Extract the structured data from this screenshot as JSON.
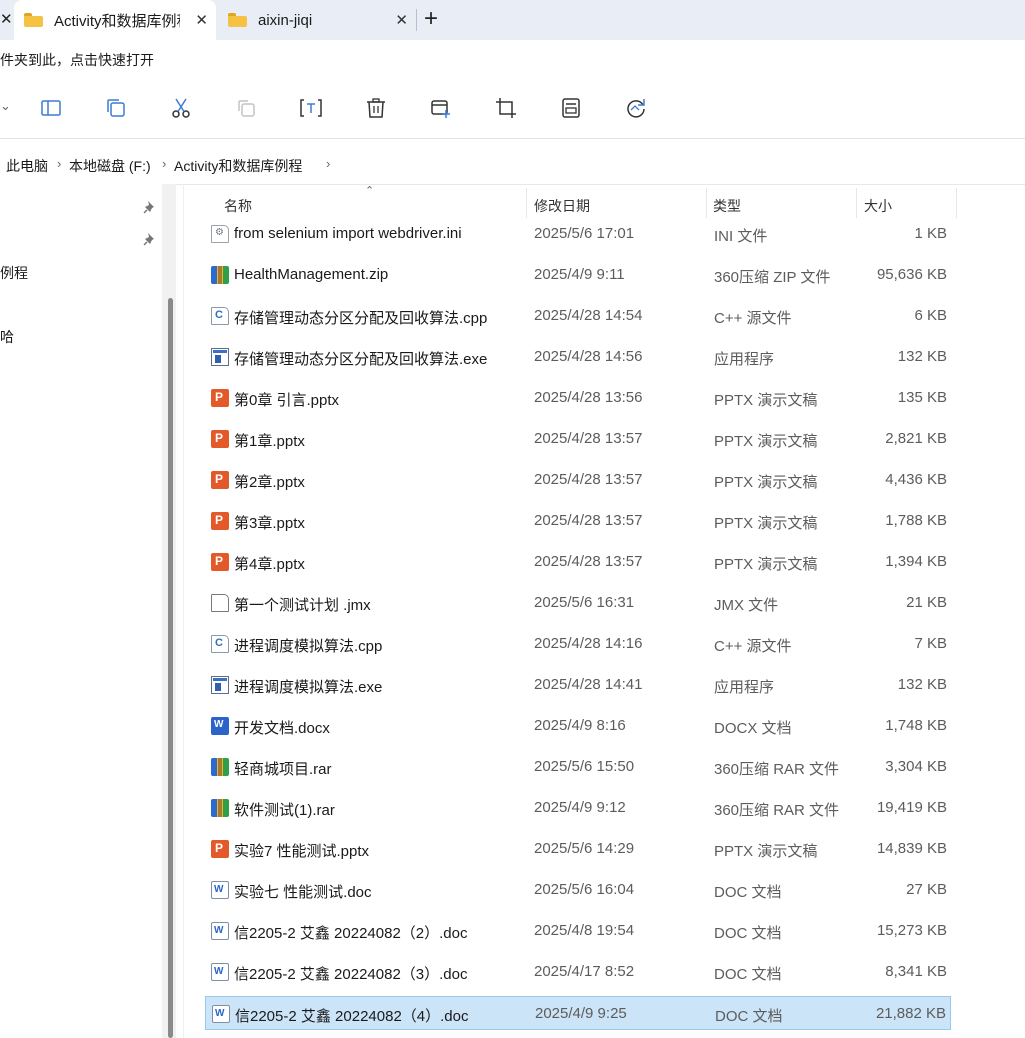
{
  "tabs": [
    {
      "title": "Activity和数据库例程",
      "active": true
    },
    {
      "title": "aixin-jiqi",
      "active": false
    }
  ],
  "infobar": {
    "text": "件夹到此，点击快速打开"
  },
  "toolbar": {
    "icons": [
      "details-pane-icon",
      "copy-icon",
      "cut-icon",
      "paste-icon",
      "rename-icon",
      "delete-icon",
      "new-icon",
      "crop-icon",
      "properties-icon",
      "refresh-icon"
    ]
  },
  "breadcrumb": [
    "此电脑",
    "本地磁盘 (F:)",
    "Activity和数据库例程"
  ],
  "nav": {
    "items": [
      "例程",
      "哈"
    ]
  },
  "columns": {
    "name": "名称",
    "date": "修改日期",
    "type": "类型",
    "size": "大小"
  },
  "files": [
    {
      "name": "from selenium import webdriver.ini",
      "date": "2025/5/6 17:01",
      "type": "INI 文件",
      "size": "1 KB",
      "icon": "ini"
    },
    {
      "name": "HealthManagement.zip",
      "date": "2025/4/9 9:11",
      "type": "360压缩 ZIP 文件",
      "size": "95,636 KB",
      "icon": "archive"
    },
    {
      "name": "存储管理动态分区分配及回收算法.cpp",
      "date": "2025/4/28 14:54",
      "type": "C++ 源文件",
      "size": "6 KB",
      "icon": "cpp"
    },
    {
      "name": "存储管理动态分区分配及回收算法.exe",
      "date": "2025/4/28 14:56",
      "type": "应用程序",
      "size": "132 KB",
      "icon": "exe"
    },
    {
      "name": "第0章 引言.pptx",
      "date": "2025/4/28 13:56",
      "type": "PPTX 演示文稿",
      "size": "135 KB",
      "icon": "pptx"
    },
    {
      "name": "第1章.pptx",
      "date": "2025/4/28 13:57",
      "type": "PPTX 演示文稿",
      "size": "2,821 KB",
      "icon": "pptx"
    },
    {
      "name": "第2章.pptx",
      "date": "2025/4/28 13:57",
      "type": "PPTX 演示文稿",
      "size": "4,436 KB",
      "icon": "pptx"
    },
    {
      "name": "第3章.pptx",
      "date": "2025/4/28 13:57",
      "type": "PPTX 演示文稿",
      "size": "1,788 KB",
      "icon": "pptx"
    },
    {
      "name": "第4章.pptx",
      "date": "2025/4/28 13:57",
      "type": "PPTX 演示文稿",
      "size": "1,394 KB",
      "icon": "pptx"
    },
    {
      "name": "第一个测试计划 .jmx",
      "date": "2025/5/6 16:31",
      "type": "JMX 文件",
      "size": "21 KB",
      "icon": "jmx"
    },
    {
      "name": "进程调度模拟算法.cpp",
      "date": "2025/4/28 14:16",
      "type": "C++ 源文件",
      "size": "7 KB",
      "icon": "cpp"
    },
    {
      "name": "进程调度模拟算法.exe",
      "date": "2025/4/28 14:41",
      "type": "应用程序",
      "size": "132 KB",
      "icon": "exe"
    },
    {
      "name": "开发文档.docx",
      "date": "2025/4/9 8:16",
      "type": "DOCX 文档",
      "size": "1,748 KB",
      "icon": "docx"
    },
    {
      "name": "轻商城项目.rar",
      "date": "2025/5/6 15:50",
      "type": "360压缩 RAR 文件",
      "size": "3,304 KB",
      "icon": "archive"
    },
    {
      "name": "软件测试(1).rar",
      "date": "2025/4/9 9:12",
      "type": "360压缩 RAR 文件",
      "size": "19,419 KB",
      "icon": "archive"
    },
    {
      "name": "实验7 性能测试.pptx",
      "date": "2025/5/6 14:29",
      "type": "PPTX 演示文稿",
      "size": "14,839 KB",
      "icon": "pptx"
    },
    {
      "name": "实验七 性能测试.doc",
      "date": "2025/5/6 16:04",
      "type": "DOC 文档",
      "size": "27 KB",
      "icon": "doc"
    },
    {
      "name": "信2205-2 艾鑫 20224082（2）.doc",
      "date": "2025/4/8 19:54",
      "type": "DOC 文档",
      "size": "15,273 KB",
      "icon": "doc"
    },
    {
      "name": "信2205-2 艾鑫 20224082（3）.doc",
      "date": "2025/4/17 8:52",
      "type": "DOC 文档",
      "size": "8,341 KB",
      "icon": "doc"
    },
    {
      "name": "信2205-2 艾鑫 20224082（4）.doc",
      "date": "2025/4/9 9:25",
      "type": "DOC 文档",
      "size": "21,882 KB",
      "icon": "doc",
      "selected": true
    }
  ]
}
